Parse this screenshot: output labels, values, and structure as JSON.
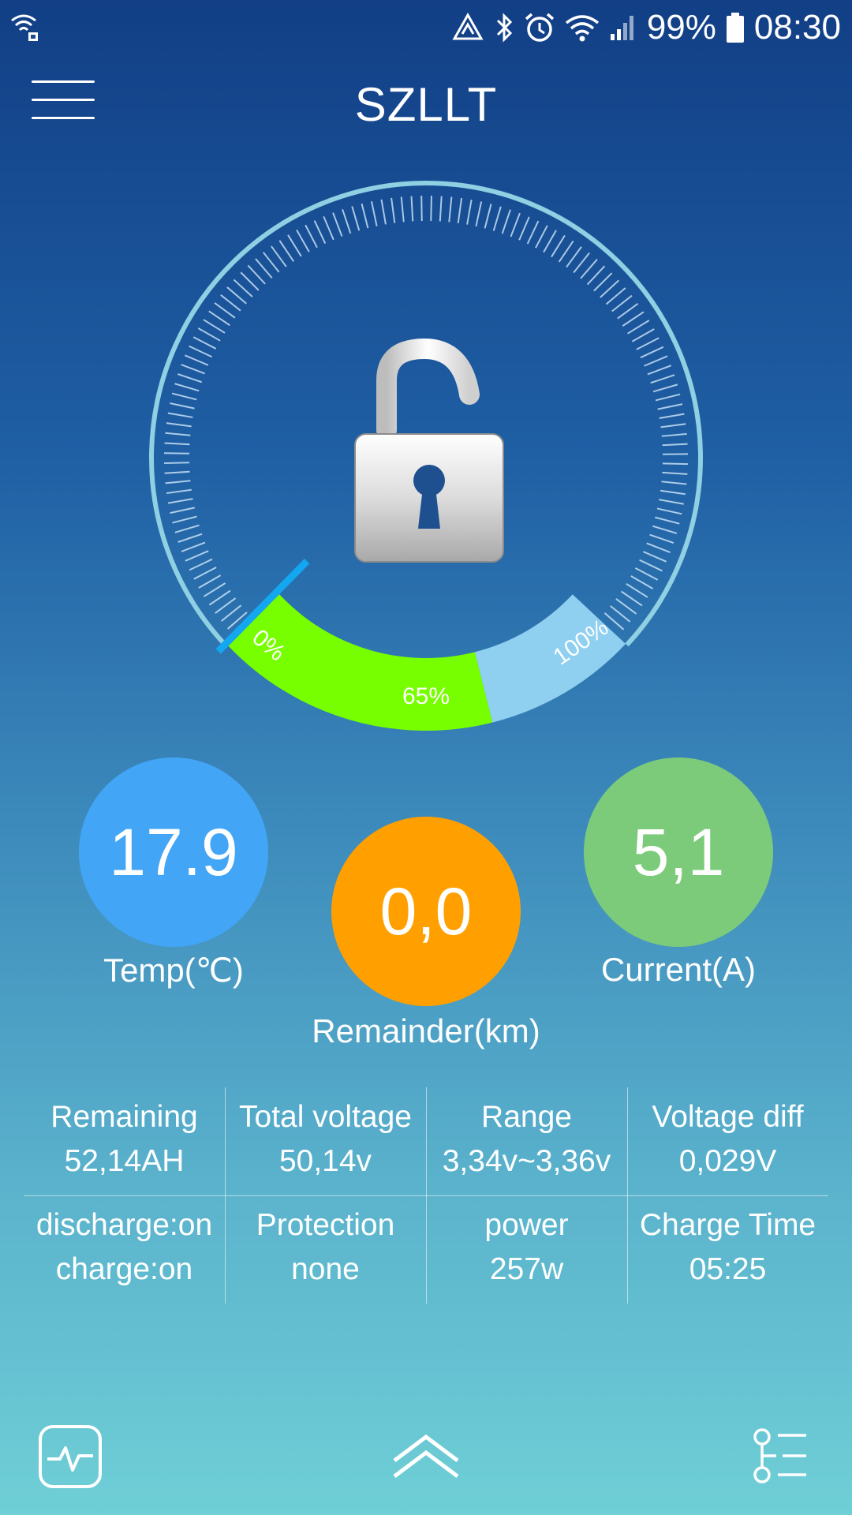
{
  "status_bar": {
    "battery_percent": "99%",
    "time": "08:30",
    "icons": [
      "wifi-lock-icon",
      "drive-icon",
      "bluetooth-icon",
      "alarm-icon",
      "wifi-icon",
      "signal-icon",
      "battery-icon"
    ]
  },
  "header": {
    "title": "SZLLT",
    "menu_icon": "hamburger-menu-icon"
  },
  "gauge": {
    "center_icon": "unlocked-padlock-icon",
    "labels": {
      "min": "0%",
      "current": "65%",
      "max": "100%"
    },
    "charge_level": 0.65,
    "colors": {
      "charged": "#77ff00",
      "uncharged": "#8fcff0",
      "needle": "#12a7f0",
      "ring": "#8fd0e2"
    }
  },
  "stats": {
    "temp": {
      "value": "17.9",
      "label": "Temp(℃)",
      "color": "#42a5f5"
    },
    "remainder": {
      "value": "0,0",
      "label": "Remainder(km)",
      "color": "#ffa000"
    },
    "current": {
      "value": "5,1",
      "label": "Current(A)",
      "color": "#7ccb7a"
    }
  },
  "info": {
    "remaining": {
      "title": "Remaining",
      "value": "52,14AH"
    },
    "total_voltage": {
      "title": "Total voltage",
      "value": "50,14v"
    },
    "range": {
      "title": "Range",
      "value": "3,34v~3,36v"
    },
    "voltage_diff": {
      "title": "Voltage diff",
      "value": "0,029V"
    },
    "discharge": {
      "title": "discharge:on",
      "value": "charge:on"
    },
    "protection": {
      "title": "Protection",
      "value": "none"
    },
    "power": {
      "title": "power",
      "value": "257w"
    },
    "charge_time": {
      "title": "Charge Time",
      "value": "05:25"
    }
  },
  "bottom_nav": {
    "left_icon": "pulse-monitor-icon",
    "center_icon": "double-chevron-up-icon",
    "right_icon": "timeline-list-icon"
  }
}
